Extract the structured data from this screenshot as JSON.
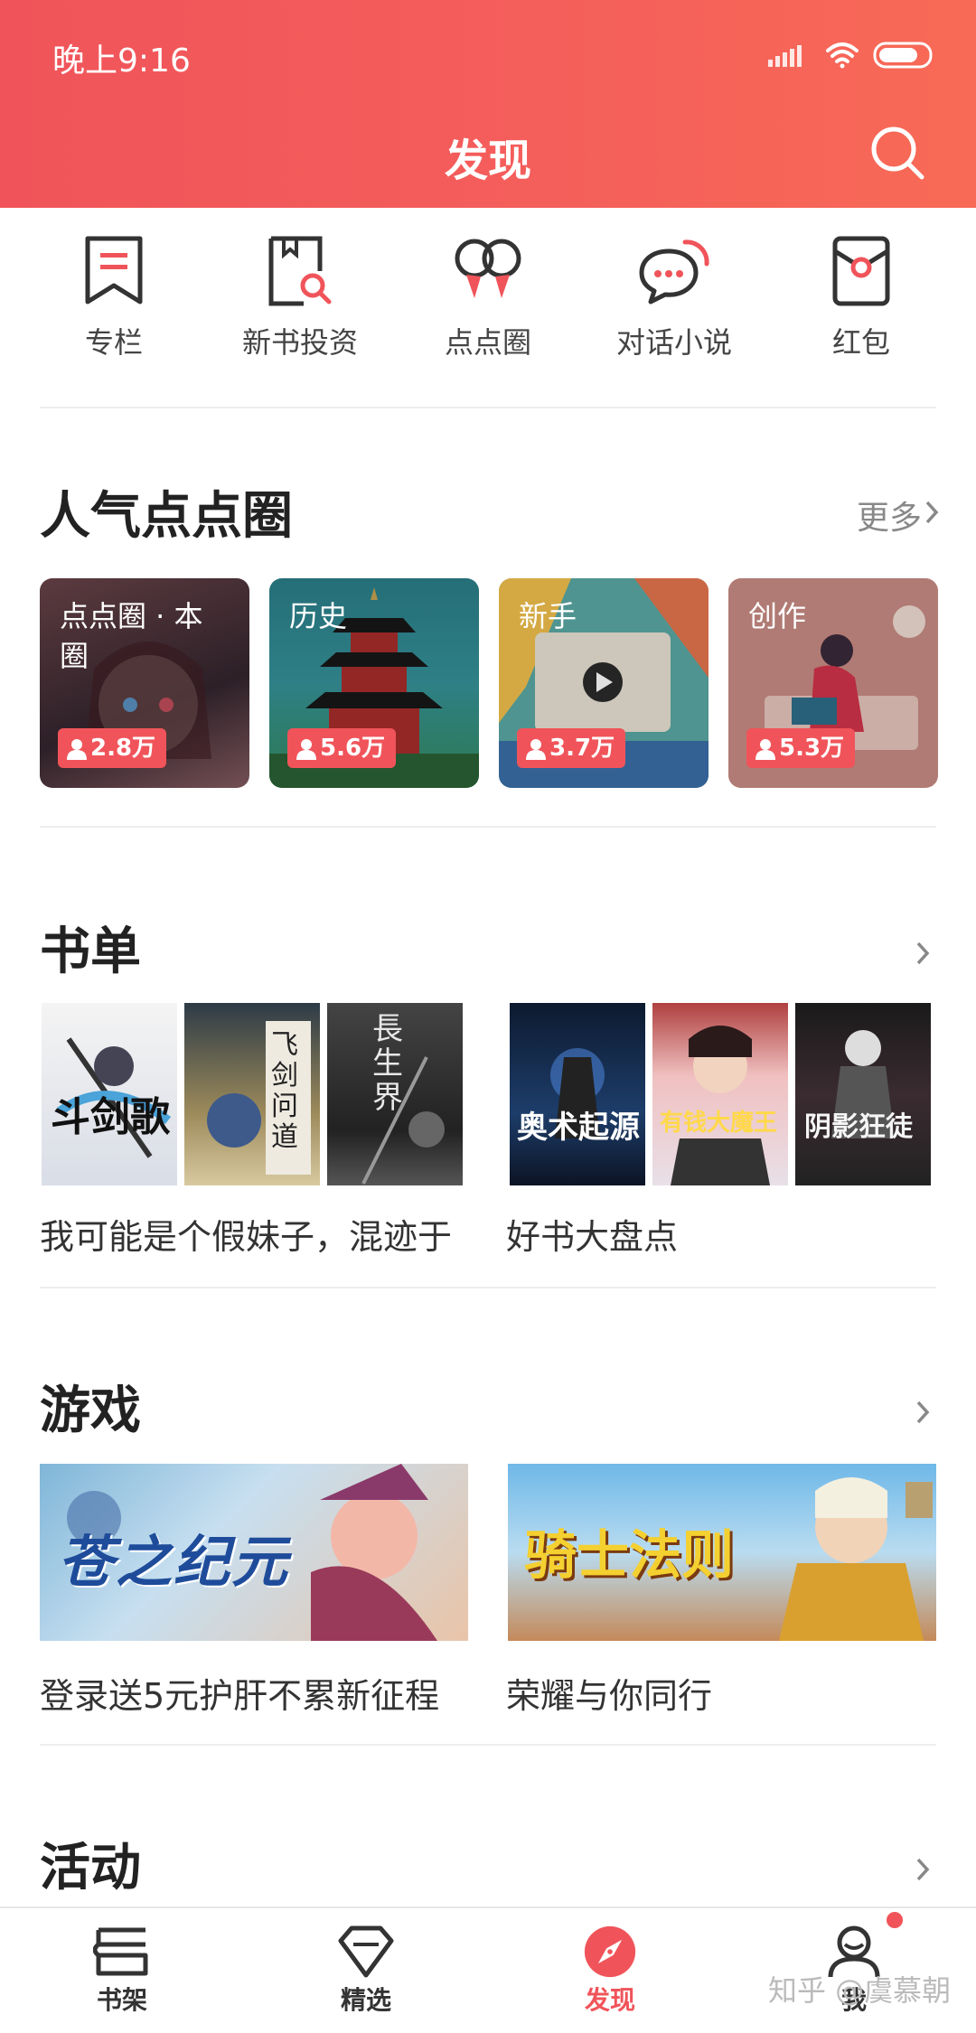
{
  "status_bar": {
    "time": "晚上9:16"
  },
  "header": {
    "title": "发现"
  },
  "quick_links": [
    {
      "label": "专栏",
      "icon": "bookmark-icon"
    },
    {
      "label": "新书投资",
      "icon": "book-search-icon"
    },
    {
      "label": "点点圈",
      "icon": "circles-icon"
    },
    {
      "label": "对话小说",
      "icon": "chat-bubble-icon"
    },
    {
      "label": "红包",
      "icon": "red-envelope-icon"
    }
  ],
  "popular_circles": {
    "title": "人气点点圈",
    "more": "更多",
    "items": [
      {
        "label": "点点圈 · 本圈",
        "count": "2.8万"
      },
      {
        "label": "历史",
        "count": "5.6万"
      },
      {
        "label": "新手",
        "count": "3.7万"
      },
      {
        "label": "创作",
        "count": "5.3万"
      }
    ]
  },
  "booklists": {
    "title": "书单",
    "items": [
      {
        "caption": "我可能是个假妹子，混迹于",
        "covers": [
          "斗剑歌",
          "飞剑问道",
          "長生界"
        ]
      },
      {
        "caption": "好书大盘点",
        "covers": [
          "奥术起源",
          "有钱大魔王",
          "阴影狂徒"
        ]
      }
    ]
  },
  "games": {
    "title": "游戏",
    "items": [
      {
        "caption": "登录送5元护肝不累新征程",
        "banner_title": "苍之纪元"
      },
      {
        "caption": "荣耀与你同行",
        "banner_title": "骑士法则"
      }
    ]
  },
  "activities": {
    "title": "活动"
  },
  "bottom_nav": [
    {
      "label": "书架",
      "icon": "bookshelf-icon"
    },
    {
      "label": "精选",
      "icon": "diamond-icon"
    },
    {
      "label": "发现",
      "icon": "compass-icon",
      "active": true
    },
    {
      "label": "我",
      "icon": "user-icon"
    }
  ],
  "watermark": "知乎 @虞慕朝",
  "colors": {
    "brand": "#f0545a",
    "text": "#222222",
    "muted": "#888888"
  }
}
